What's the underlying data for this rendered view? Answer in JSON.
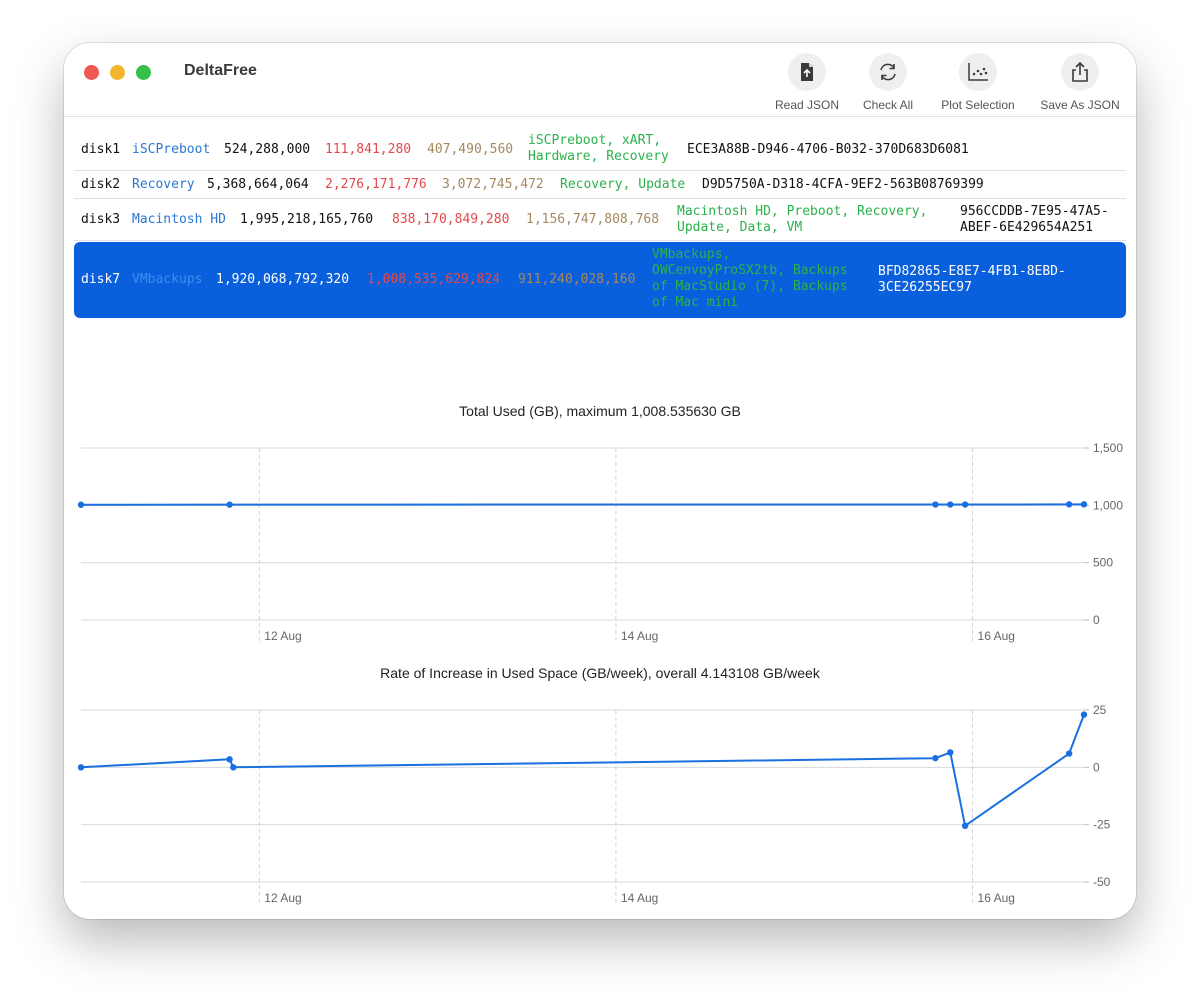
{
  "app": {
    "title": "DeltaFree"
  },
  "toolbar": {
    "read_json": "Read JSON",
    "check_all": "Check All",
    "plot_selection": "Plot Selection",
    "save_as_json": "Save As JSON"
  },
  "icons": {
    "read_json": "document-upload-icon",
    "check_all": "refresh-icon",
    "plot_selection": "scatter-plot-icon",
    "save_as_json": "share-icon"
  },
  "colors": {
    "name": "#2a78d4",
    "used": "#e5484d",
    "free": "#a58860",
    "volumes": "#2bb24c",
    "selection": "#0a60dc",
    "line": "#1b70e0"
  },
  "rows": [
    {
      "disk": "disk1",
      "name": "iSCPreboot",
      "size": "524,288,000",
      "used": "111,841,280",
      "free": "407,490,560",
      "volumes": "iSCPreboot, xART, Hardware, Recovery",
      "uuid": "ECE3A88B-D946-4706-B032-370D683D6081"
    },
    {
      "disk": "disk2",
      "name": "Recovery",
      "size": "5,368,664,064",
      "used": "2,276,171,776",
      "free": "3,072,745,472",
      "volumes": "Recovery, Update",
      "uuid": "D9D5750A-D318-4CFA-9EF2-563B08769399"
    },
    {
      "disk": "disk3",
      "name": "Macintosh HD",
      "size": "1,995,218,165,760",
      "used": "838,170,849,280",
      "free": "1,156,747,808,768",
      "volumes": "Macintosh HD, Preboot, Recovery, Update, Data, VM",
      "uuid": "956CCDDB-7E95-47A5-ABEF-6E429654A251"
    },
    {
      "disk": "disk7",
      "name": "VMbackups",
      "size": "1,920,068,792,320",
      "used": "1,008,535,629,824",
      "free": "911,240,028,160",
      "volumes": "VMbackups, OWCenvoyProSX2tb, Backups of MacStudio (7), Backups of Mac mini",
      "uuid": "BFD82865-E8E7-4FB1-8EBD-3CE26255EC97"
    }
  ],
  "chart_data": [
    {
      "type": "line",
      "title": "Total Used (GB), maximum 1,008.535630 GB",
      "x_ticks": [
        "12 Aug",
        "14 Aug",
        "16 Aug"
      ],
      "x_tick_dates": [
        "2023-08-12",
        "2023-08-14",
        "2023-08-16"
      ],
      "y_ticks": [
        "1,500",
        "1,000",
        "500",
        "0"
      ],
      "ylim": [
        0,
        1500
      ],
      "grid": true,
      "series": [
        {
          "x": [
            "2023-08-11 00:00",
            "2023-08-11 20:00",
            "2023-08-15 19:00",
            "2023-08-15 21:00",
            "2023-08-15 23:00",
            "2023-08-16 13:00",
            "2023-08-16 15:00"
          ],
          "y": [
            1005,
            1006,
            1007,
            1007,
            1007,
            1008.5,
            1008.5
          ]
        }
      ]
    },
    {
      "type": "line",
      "title": "Rate of Increase in Used Space (GB/week), overall 4.143108 GB/week",
      "x_ticks": [
        "12 Aug",
        "14 Aug",
        "16 Aug"
      ],
      "x_tick_dates": [
        "2023-08-12",
        "2023-08-14",
        "2023-08-16"
      ],
      "y_ticks": [
        "25",
        "0",
        "-25",
        "-50"
      ],
      "ylim": [
        -50,
        25
      ],
      "grid": true,
      "series": [
        {
          "x": [
            "2023-08-11 00:00",
            "2023-08-11 20:00",
            "2023-08-11 20:30",
            "2023-08-15 19:00",
            "2023-08-15 21:00",
            "2023-08-15 23:00",
            "2023-08-16 13:00",
            "2023-08-16 15:00"
          ],
          "y": [
            0,
            3.5,
            0,
            4,
            6.5,
            -25.5,
            6,
            23
          ]
        }
      ]
    }
  ]
}
